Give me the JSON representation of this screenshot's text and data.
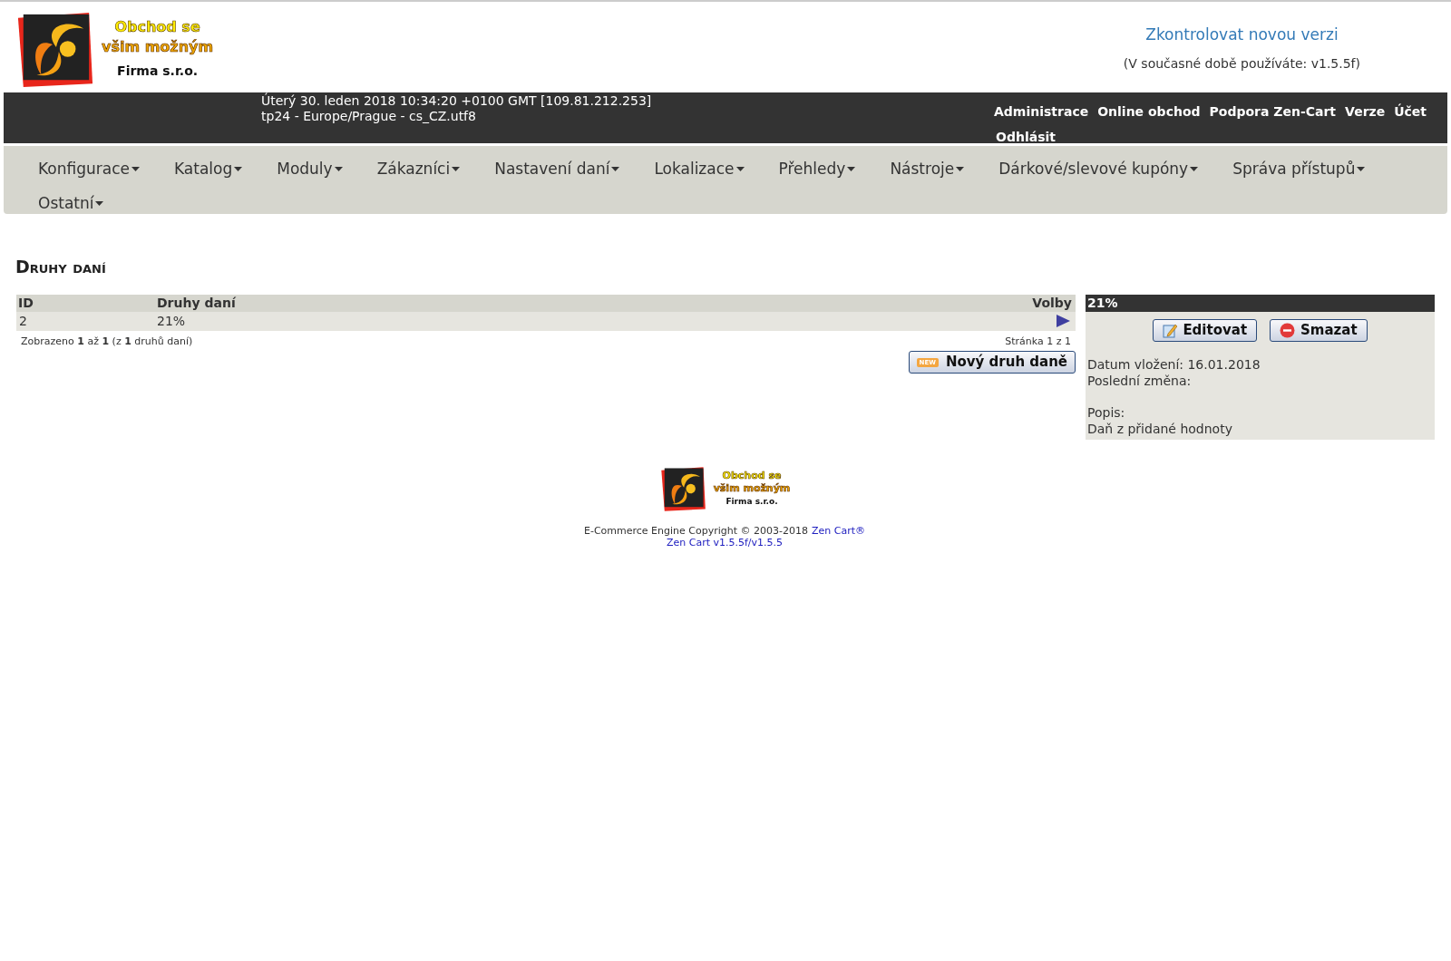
{
  "logo": {
    "line_1": "Obchod se",
    "line_2": "všim možným",
    "line_3": "Firma s.r.o."
  },
  "version_check": {
    "link": "Zkontrolovat novou verzi",
    "current": "(V současné době používáte: v1.5.5f)"
  },
  "info_bar": {
    "datetime": "Úterý 30. leden 2018 10:34:20 +0100 GMT [109.81.212.253]",
    "locale": "tp24 - Europe/Prague - cs_CZ.utf8",
    "links": [
      "Administrace",
      "Online obchod",
      "Podpora Zen-Cart",
      "Verze",
      "Účet",
      "Odhlásit"
    ]
  },
  "menu": [
    "Konfigurace",
    "Katalog",
    "Moduly",
    "Zákazníci",
    "Nastavení daní",
    "Lokalizace",
    "Přehledy",
    "Nástroje",
    "Dárkové/slevové kupóny",
    "Správa přístupů",
    "Ostatní"
  ],
  "page_title": "Druhy daní",
  "table": {
    "columns": [
      "ID",
      "Druhy daní",
      "Volby"
    ],
    "rows": [
      {
        "id": "2",
        "name": "21%",
        "selected": true
      }
    ],
    "summary": "Zobrazeno **1** až **1** (z **1** druhů daní)",
    "pages": "Stránka 1 z 1",
    "new_button": {
      "badge": "NEW",
      "label": "Nový druh daně"
    }
  },
  "detail": {
    "title": "21%",
    "buttons": [
      {
        "kind": "edit",
        "label": "Editovat"
      },
      {
        "kind": "delete",
        "label": "Smazat"
      }
    ],
    "date_added": "Datum vložení: 16.01.2018",
    "last_modified": "Poslední změna:",
    "description_label": "Popis:",
    "description": "Daň z přidané hodnoty"
  },
  "footer": {
    "logo": {
      "line_1": "Obchod se",
      "line_2": "všim možným",
      "line_3": "Firma s.r.o."
    },
    "copyright": "E-Commerce Engine Copyright © 2003-2018",
    "link_1": "Zen Cart®",
    "link_2": "Zen Cart v1.5.5f/v1.5.5"
  }
}
